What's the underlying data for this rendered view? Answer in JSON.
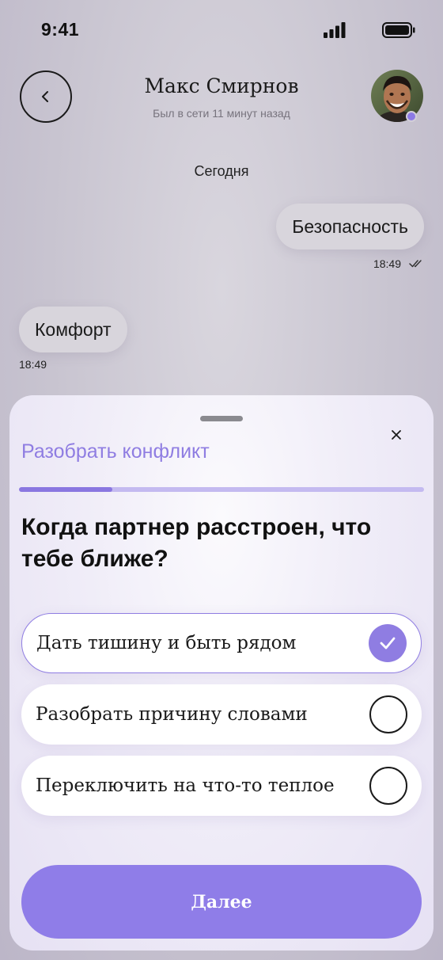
{
  "status_bar": {
    "time": "9:41"
  },
  "header": {
    "name": "Макс Смирнов",
    "status": "Был в сети 11 минут назад"
  },
  "chat": {
    "date_divider": "Сегодня",
    "messages": [
      {
        "direction": "outgoing",
        "text": "Безопасность",
        "time": "18:49",
        "read": true
      },
      {
        "direction": "incoming",
        "text": "Комфорт",
        "time": "18:49"
      }
    ]
  },
  "sheet": {
    "title": "Разобрать конфликт",
    "progress": 0.23,
    "question": "Когда партнер расстроен, что тебе ближе?",
    "options": [
      {
        "label": "Дать тишину и быть рядом",
        "selected": true
      },
      {
        "label": "Разобрать причину словами",
        "selected": false
      },
      {
        "label": "Переключить на что-то теплое",
        "selected": false
      }
    ],
    "next_label": "Далее"
  },
  "colors": {
    "accent": "#8f7de2",
    "button": "#8f7de8",
    "online": "#8c7ae6"
  },
  "icons": [
    "signal-icon",
    "battery-icon",
    "chevron-left-icon",
    "double-check-icon",
    "close-icon",
    "checkmark-icon"
  ]
}
